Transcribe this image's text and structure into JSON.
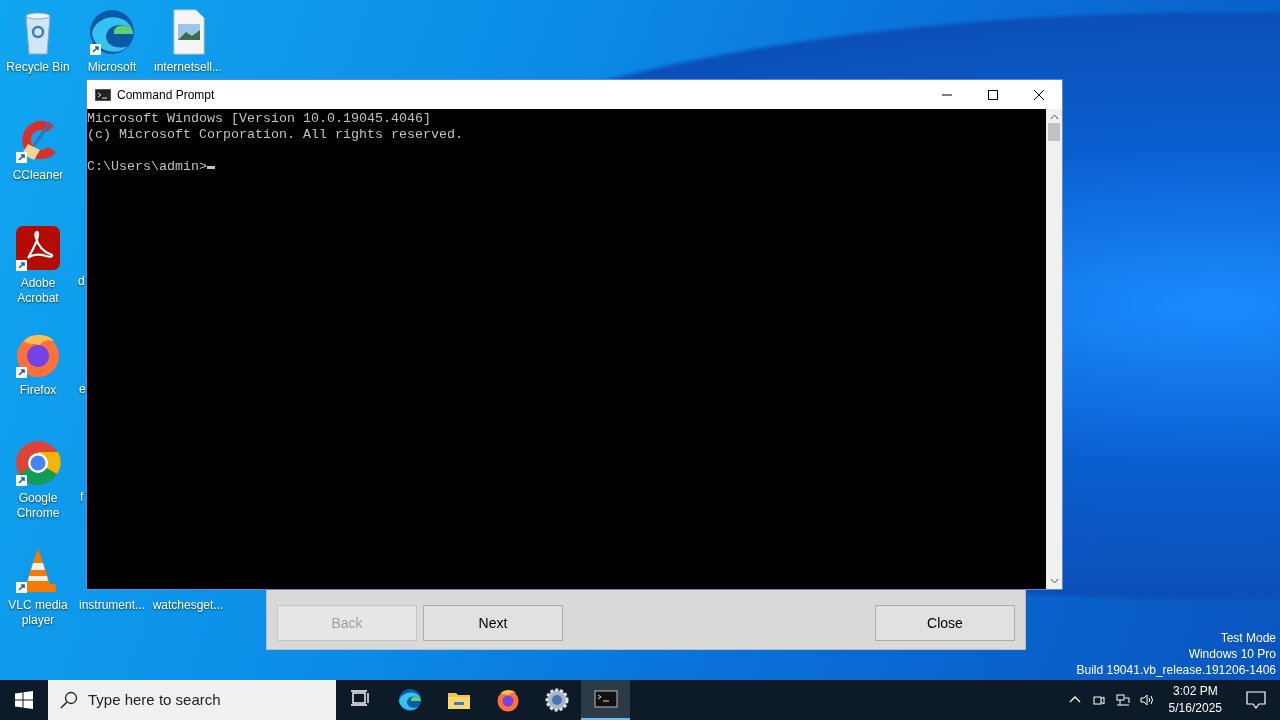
{
  "desktop_icons": [
    {
      "label": "Recycle Bin",
      "kind": "recycle-bin"
    },
    {
      "label": "Microsoft",
      "kind": "edge"
    },
    {
      "label": "internetsell...",
      "kind": "image-file"
    },
    {
      "label": "CCleaner",
      "kind": "ccleaner"
    },
    {
      "label": "Adobe Acrobat",
      "kind": "acrobat"
    },
    {
      "label": "d",
      "kind": "covered"
    },
    {
      "label": "Firefox",
      "kind": "firefox"
    },
    {
      "label": "e",
      "kind": "covered"
    },
    {
      "label": "Google Chrome",
      "kind": "chrome"
    },
    {
      "label": "f",
      "kind": "covered"
    },
    {
      "label": "VLC media player",
      "kind": "vlc"
    },
    {
      "label": "instrument...",
      "kind": "hidden-file"
    },
    {
      "label": "watchesget...",
      "kind": "hidden-file"
    }
  ],
  "dialog": {
    "buttons": [
      {
        "label": "Back",
        "disabled": true
      },
      {
        "label": "Next",
        "disabled": false
      },
      {
        "label": "Close",
        "disabled": false
      }
    ]
  },
  "window": {
    "title": "Command Prompt",
    "output": [
      "Microsoft Windows [Version 10.0.19045.4046]",
      "(c) Microsoft Corporation. All rights reserved."
    ],
    "prompt": "C:\\Users\\admin>"
  },
  "watermark": [
    "Test Mode",
    "Windows 10 Pro",
    "Build 19041.vb_release.191206-1406"
  ],
  "taskbar": {
    "search": {
      "placeholder": "Type here to search"
    },
    "apps": [
      {
        "kind": "task-view",
        "selected": false
      },
      {
        "kind": "edge",
        "selected": false
      },
      {
        "kind": "explorer",
        "selected": false
      },
      {
        "kind": "firefox",
        "selected": false
      },
      {
        "kind": "settings",
        "selected": false
      },
      {
        "kind": "cmd",
        "selected": true
      }
    ],
    "time": "3:02 PM",
    "date": "5/16/2025"
  }
}
